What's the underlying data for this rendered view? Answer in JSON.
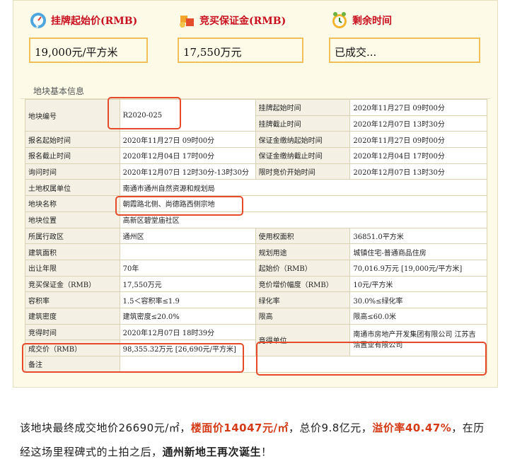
{
  "cards": [
    {
      "label": "挂牌起始价(RMB)",
      "icon": "price-gauge-icon",
      "value": "19,000元/平方米"
    },
    {
      "label": "竞买保证金(RMB)",
      "icon": "deposit-icon",
      "value": "17,550万元"
    },
    {
      "label": "剩余时间",
      "icon": "clock-icon",
      "value": "已成交..."
    }
  ],
  "section_title": "地块基本信息",
  "table": {
    "listing_start_label": "挂牌起始时间",
    "listing_start_value": "2020年11月27日 09时00分",
    "listing_end_label": "挂牌截止时间",
    "listing_end_value": "2020年12月07日 13时30分",
    "parcel_no_label": "地块编号",
    "parcel_no_value": "R2020-025",
    "rows": [
      {
        "l1": "报名起始时间",
        "v1": "2020年11月27日 09时00分",
        "l2": "保证金缴纳起始时间",
        "v2": "2020年11月27日 09时00分"
      },
      {
        "l1": "报名截止时间",
        "v1": "2020年12月04日 17时00分",
        "l2": "保证金缴纳截止时间",
        "v2": "2020年12月04日 17时00分"
      },
      {
        "l1": "询问时间",
        "v1": "2020年12月07日 12时30分-13时30分",
        "l2": "限时竞价开始时间",
        "v2": "2020年12月07日 13时30分"
      }
    ],
    "owner_label": "土地权属单位",
    "owner_value": "南通市通州自然资源和规划局",
    "name_label": "地块名称",
    "name_value": "朝霞路北侧、尚德路西侧宗地",
    "location_label": "地块位置",
    "location_value": "高新区碧堂庙社区",
    "rows2": [
      {
        "l1": "所属行政区",
        "v1": "通州区",
        "l2": "使用权面积",
        "v2": "36851.0平方米"
      },
      {
        "l1": "建筑面积",
        "v1": "",
        "l2": "规划用途",
        "v2": "城镇住宅-普通商品住房"
      },
      {
        "l1": "出让年限",
        "v1": "70年",
        "l2": "起始价（RMB）",
        "v2": "70,016.9万元 [19,000元/平方米]"
      },
      {
        "l1": "竞买保证金（RMB）",
        "v1": "17,550万元",
        "l2": "竞价增价幅度（RMB）",
        "v2": "10元/平方米"
      },
      {
        "l1": "容积率",
        "v1": "1.5＜容积率≤1.9",
        "l2": "绿化率",
        "v2": "30.0%≤绿化率"
      },
      {
        "l1": "建筑密度",
        "v1": "建筑密度≤20.0%",
        "l2": "限高",
        "v2": "限高≤60.0米"
      }
    ],
    "bid_time_label": "竞得时间",
    "bid_time_value": "2020年12月07日 18时39分",
    "deal_price_label": "成交价（RMB）",
    "deal_price_value": "98,355.32万元 [26,690元/平方米]",
    "winner_label": "竞得单位",
    "winner_line1": "南通市房地产开发集团有限公司 江苏吉",
    "winner_line2": "浩置业有限公司",
    "remark_label": "备注"
  },
  "caption": {
    "p1": "该地块最终成交地价26690元/㎡，",
    "p2": "楼面价14047元/㎡",
    "p3": "，总价9.8亿元，",
    "p4": "溢价率40.47%",
    "p5": "，在历经这场里程碑式的土拍之后，",
    "p6": "通州新地王再次诞生",
    "p7": "！"
  },
  "colors": {
    "accent_red": "#c8101f",
    "highlight_box": "#e74a2a",
    "value_border": "#f1be57",
    "caption_red": "#d43a16"
  }
}
